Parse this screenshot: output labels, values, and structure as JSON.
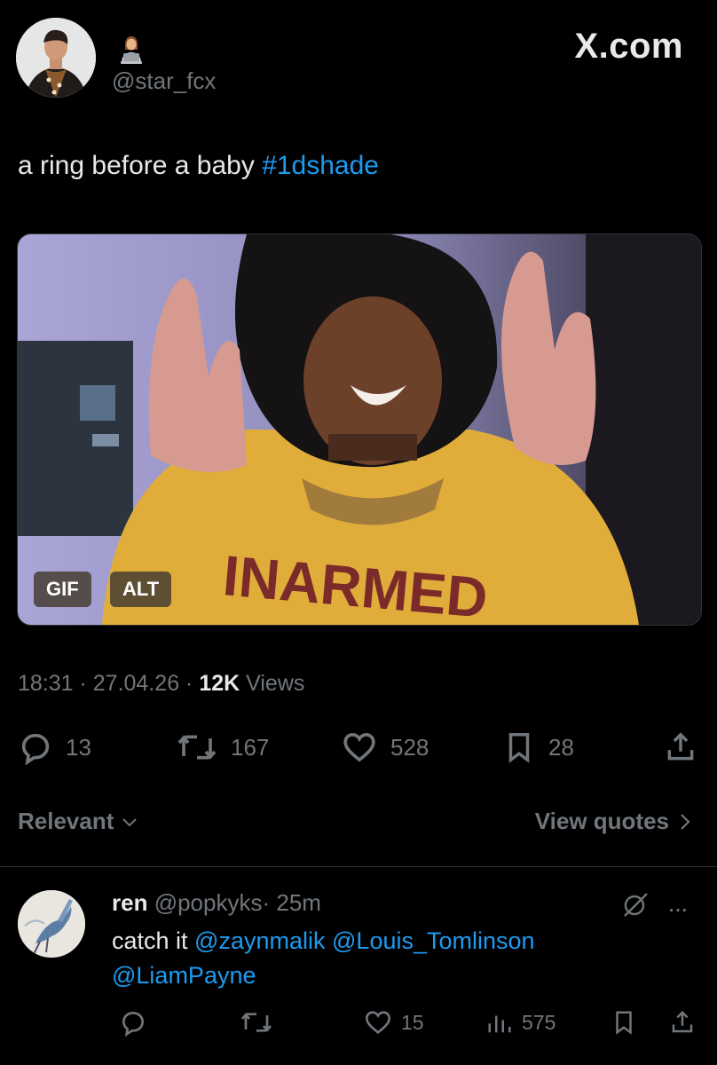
{
  "header": {
    "handle": "@star_fcx",
    "brand": "X.com"
  },
  "tweet": {
    "text": "a ring before a baby ",
    "hashtag": "#1dshade",
    "media": {
      "badges": [
        "GIF",
        "ALT"
      ],
      "shirt_text": "INARMED"
    },
    "time": "18:31 · 27.04.26 · ",
    "views_count": "12K",
    "views_label": " Views",
    "actions": {
      "replies": "13",
      "reposts": "167",
      "likes": "528",
      "bookmarks": "28"
    }
  },
  "sort": {
    "label": "Relevant",
    "view_quotes": "View quotes"
  },
  "reply": {
    "name": "ren",
    "handle": "@popkyks",
    "time": "· 25m",
    "text_prefix": "catch it ",
    "mentions": [
      "@zaynmalik",
      "@Louis_Tomlinson",
      "@LiamPayne"
    ],
    "more": "···",
    "actions": {
      "likes": "15",
      "views": "575"
    }
  },
  "colors": {
    "background": "#000000",
    "text": "#e7e9ea",
    "secondary": "#71767b",
    "link": "#1d9bf0",
    "divider": "#2f3336"
  },
  "icons": [
    "person-laptop-emoji-icon",
    "reply-icon",
    "repost-icon",
    "heart-icon",
    "bookmark-icon",
    "share-icon",
    "chevron-down-icon",
    "chevron-right-icon",
    "grok-icon",
    "more-icon",
    "analytics-icon"
  ]
}
